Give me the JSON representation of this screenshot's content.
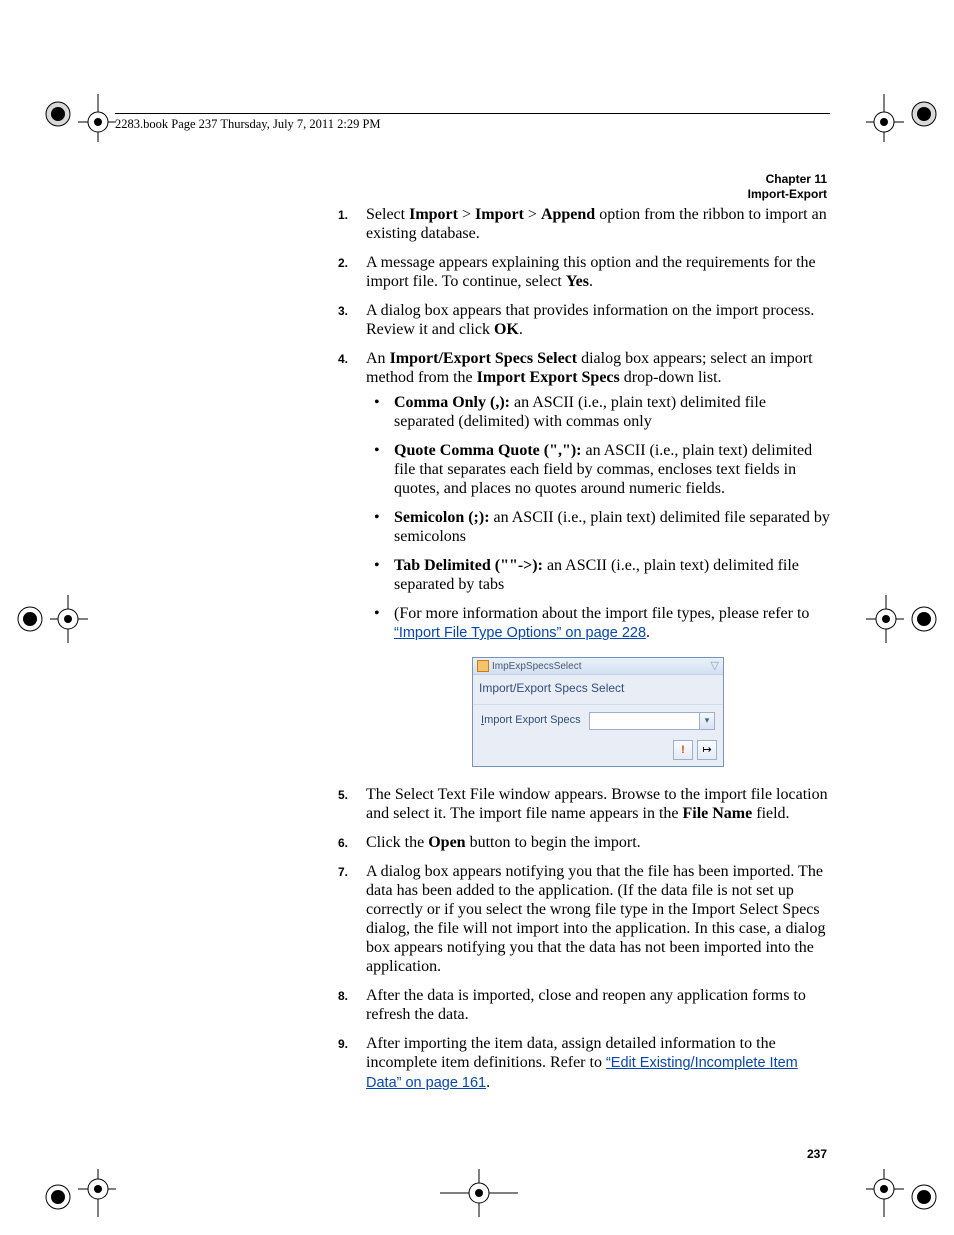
{
  "running_head": "2283.book  Page 237  Thursday, July 7, 2011  2:29 PM",
  "chapter_line1": "Chapter 11",
  "chapter_line2": "Import-Export",
  "page_number": "237",
  "steps": {
    "s1": {
      "num": "1.",
      "pre": "Select ",
      "b1": "Import",
      "mid1": " > ",
      "b2": "Import",
      "mid2": " > ",
      "b3": "Append",
      "tail": " option from the ribbon to import an existing database."
    },
    "s2": {
      "num": "2.",
      "pre": "A message appears explaining this option and the requirements for the import file. To continue, select ",
      "b1": "Yes",
      "tail": "."
    },
    "s3": {
      "num": "3.",
      "pre": "A dialog box appears that provides information on the import process. Review it and click ",
      "b1": "OK",
      "tail": "."
    },
    "s4": {
      "num": "4.",
      "pre": "An ",
      "b1": "Import/Export Specs Select",
      "mid1": " dialog box appears; select an import method from the ",
      "b2": "Import Export Specs",
      "tail": " drop-down list."
    },
    "s4_items": {
      "a": {
        "b": "Comma Only (,):",
        "t": " an ASCII (i.e., plain text) delimited file separated (delimited) with commas only"
      },
      "b": {
        "b": "Quote Comma Quote (\",\"):",
        "t": " an ASCII (i.e., plain text) delimited file that separates each field by commas, encloses text fields in quotes, and places no quotes around numeric fields."
      },
      "c": {
        "b": "Semicolon (;):",
        "t": " an ASCII (i.e., plain text) delimited file separated by semicolons"
      },
      "d": {
        "b": "Tab Delimited  (\"\"->):",
        "t": " an ASCII (i.e., plain text) delimited file separated by tabs"
      },
      "e": {
        "pre": "(For more information about the import file types, please refer to ",
        "link": "“Import File Type Options” on page 228",
        "tail": "."
      }
    },
    "s5": {
      "num": "5.",
      "pre": "The Select Text File window appears. Browse to the import file location and select it. The import file name appears in the ",
      "b1": "File Name",
      "tail": " field."
    },
    "s6": {
      "num": "6.",
      "pre": "Click the ",
      "b1": "Open",
      "tail": " button to begin the import."
    },
    "s7": {
      "num": "7.",
      "t": "A dialog box appears notifying you that the file has been imported. The data has been added to the application. (If the data file is not set up correctly or if you select the wrong file type in the Import Select Specs dialog, the file will not import into the application. In this case, a dialog box appears notifying you that the data has not been imported into the application."
    },
    "s8": {
      "num": "8.",
      "t": "After the data is imported, close and reopen any application forms to refresh the data."
    },
    "s9": {
      "num": "9.",
      "pre": "After importing the item data, assign detailed information to the incomplete item definitions. Refer to ",
      "link": "“Edit Existing/Incomplete Item Data” on page 161",
      "tail": "."
    }
  },
  "dialog": {
    "window_title": "ImpExpSpecsSelect",
    "header": "Import/Export Specs Select",
    "label_underline": "I",
    "label_rest": "mport Export Specs",
    "warn_glyph": "!",
    "exit_glyph": "↦",
    "dropdown_glyph": "▾",
    "close_glyph": "▽"
  }
}
